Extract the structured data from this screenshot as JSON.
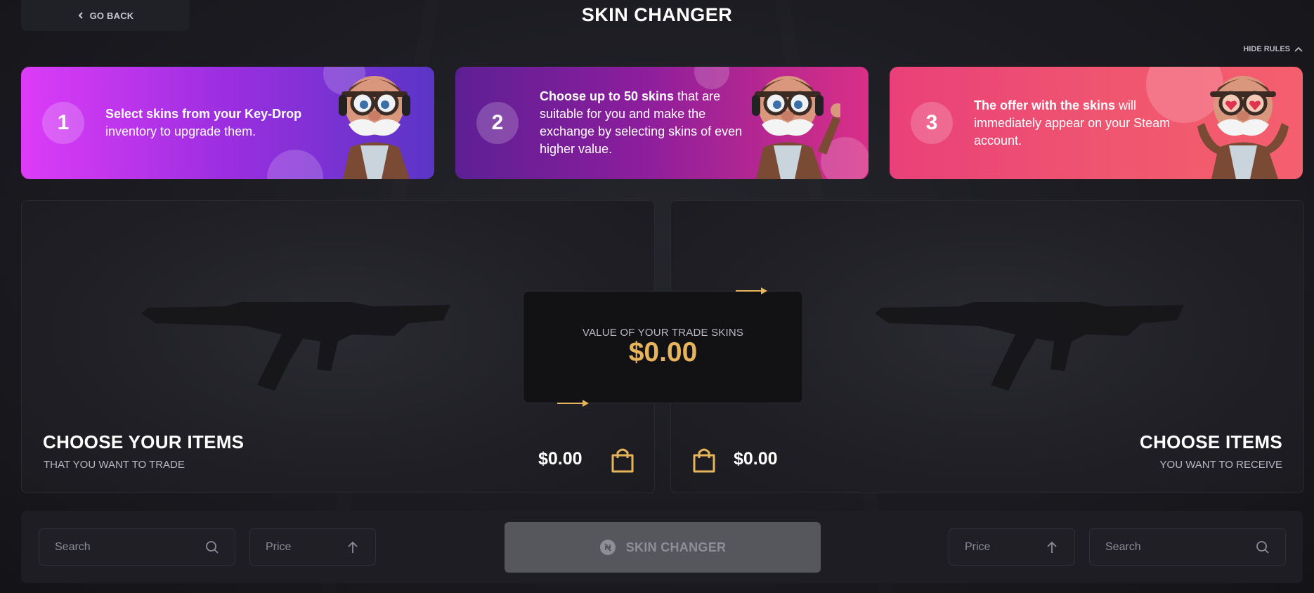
{
  "header": {
    "back_label": "GO BACK",
    "title": "SKIN CHANGER",
    "hide_rules_label": "HIDE RULES"
  },
  "rules": [
    {
      "number": "1",
      "bold": "Select skins from your Key-Drop",
      "rest": " inventory to upgrade them."
    },
    {
      "number": "2",
      "bold": "Choose up to 50 skins",
      "rest": " that are suitable for you and make the exchange by selecting skins of even higher value."
    },
    {
      "number": "3",
      "bold": "The offer with the skins",
      "rest": " will immediately appear on your Steam account."
    }
  ],
  "left_panel": {
    "title": "CHOOSE YOUR ITEMS",
    "subtitle": "THAT YOU WANT TO TRADE",
    "total": "$0.00"
  },
  "right_panel": {
    "title": "CHOOSE ITEMS",
    "subtitle": "YOU WANT TO RECEIVE",
    "total": "$0.00"
  },
  "value_box": {
    "label": "VALUE OF YOUR TRADE SKINS",
    "amount": "$0.00"
  },
  "bottom": {
    "left_search_placeholder": "Search",
    "left_price_label": "Price",
    "changer_button": "SKIN CHANGER",
    "right_price_label": "Price",
    "right_search_placeholder": "Search"
  },
  "colors": {
    "accent_gold": "#e7b45c",
    "rule1_gradient": [
      "#dd3cf8",
      "#5a35c6"
    ],
    "rule2_gradient": [
      "#5d1f95",
      "#d92f87"
    ],
    "rule3_gradient": [
      "#e9407a",
      "#f45f6e"
    ],
    "disabled_button": "#56565d"
  },
  "icons": [
    "chevron-left-icon",
    "chevron-up-icon",
    "mascot-image",
    "rifle-silhouette",
    "shopping-bag-icon",
    "arrow-right-icon",
    "search-icon",
    "arrow-up-icon",
    "skin-changer-icon"
  ]
}
